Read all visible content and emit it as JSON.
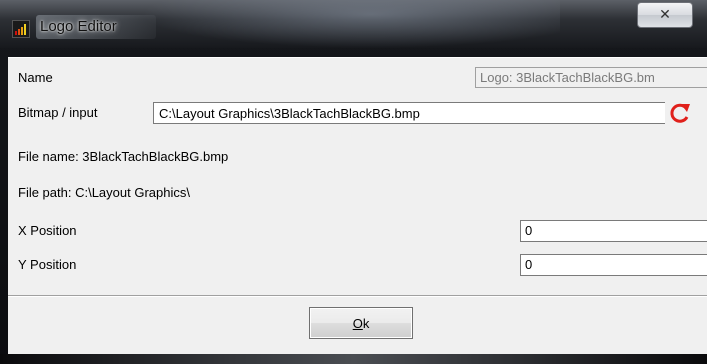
{
  "window": {
    "title": "Logo Editor",
    "close_glyph": "✕"
  },
  "form": {
    "name_label": "Name",
    "name_value": "Logo: 3BlackTachBlackBG.bm",
    "bitmap_label": "Bitmap / input",
    "bitmap_value": "C:\\Layout Graphics\\3BlackTachBlackBG.bmp",
    "file_name": "File name: 3BlackTachBlackBG.bmp",
    "file_path": "File path: C:\\Layout Graphics\\",
    "x_label": "X Position",
    "x_value": "0",
    "y_label": "Y Position",
    "y_value": "0"
  },
  "buttons": {
    "ok_mnemonic": "O",
    "ok_rest": "k"
  },
  "icons": {
    "app": "bar-chart-icon",
    "refresh": "refresh-icon",
    "dropdown": "chevron-down-icon",
    "close": "close-icon"
  },
  "colors": {
    "refresh": "#e0201b",
    "client_bg": "#f0f0f0"
  }
}
